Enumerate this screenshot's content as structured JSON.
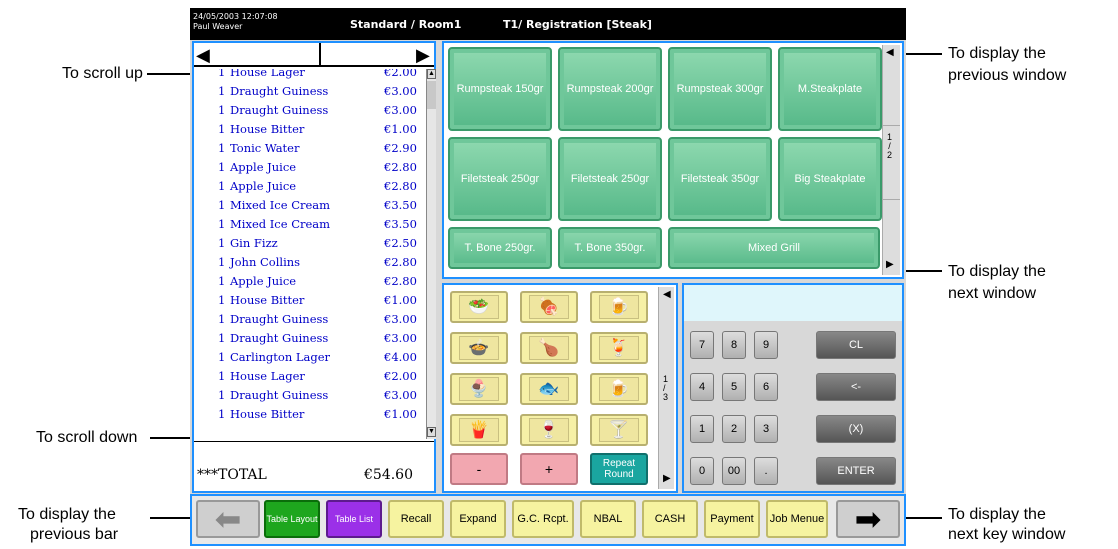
{
  "annotations": {
    "scroll_up": "To scroll up",
    "scroll_down": "To scroll down",
    "prev_bar_1": "To display the",
    "prev_bar_2": "previous bar",
    "prev_window_1": "To display the",
    "prev_window_2": "previous window",
    "next_window_1": "To display the",
    "next_window_2": "next window",
    "next_key_1": "To display the",
    "next_key_2": "next key window"
  },
  "topbar": {
    "date": "24/05/2003 12:07:08",
    "user": "Paul Weaver",
    "mode": "Standard / Room1",
    "table": "T1/ Registration [Steak]"
  },
  "order": {
    "items": [
      {
        "qty": "1",
        "name": "House Lager",
        "price": "€2.00"
      },
      {
        "qty": "1",
        "name": "Draught Guiness",
        "price": "€3.00"
      },
      {
        "qty": "1",
        "name": "Draught Guiness",
        "price": "€3.00"
      },
      {
        "qty": "1",
        "name": "House Bitter",
        "price": "€1.00"
      },
      {
        "qty": "1",
        "name": "Tonic Water",
        "price": "€2.90"
      },
      {
        "qty": "1",
        "name": "Apple Juice",
        "price": "€2.80"
      },
      {
        "qty": "1",
        "name": "Apple Juice",
        "price": "€2.80"
      },
      {
        "qty": "1",
        "name": "Mixed Ice Cream",
        "price": "€3.50"
      },
      {
        "qty": "1",
        "name": "Mixed Ice Cream",
        "price": "€3.50"
      },
      {
        "qty": "1",
        "name": "Gin Fizz",
        "price": "€2.50"
      },
      {
        "qty": "1",
        "name": "John Collins",
        "price": "€2.80"
      },
      {
        "qty": "1",
        "name": "Apple Juice",
        "price": "€2.80"
      },
      {
        "qty": "1",
        "name": "House Bitter",
        "price": "€1.00"
      },
      {
        "qty": "1",
        "name": "Draught Guiness",
        "price": "€3.00"
      },
      {
        "qty": "1",
        "name": "Draught Guiness",
        "price": "€3.00"
      },
      {
        "qty": "1",
        "name": "Carlington Lager",
        "price": "€4.00"
      },
      {
        "qty": "1",
        "name": "House Lager",
        "price": "€2.00"
      },
      {
        "qty": "1",
        "name": "Draught Guiness",
        "price": "€3.00"
      },
      {
        "qty": "1",
        "name": "House Bitter",
        "price": "€1.00"
      }
    ],
    "total_label": "***TOTAL",
    "total_value": "€54.60"
  },
  "menu": {
    "buttons": [
      "Rumpsteak 150gr",
      "Rumpsteak 200gr",
      "Rumpsteak 300gr",
      "M.Steakplate",
      "Filetsteak 250gr",
      "Filetsteak 250gr",
      "Filetsteak 350gr",
      "Big Steakplate",
      "T. Bone 250gr.",
      "T. Bone 350gr.",
      "Mixed Grill"
    ],
    "page_num": "1",
    "page_total": "2"
  },
  "icons": {
    "glyphs": [
      "🥗",
      "🍖",
      "🍺",
      "🍲",
      "🍗",
      "🍹",
      "🍨",
      "🐟",
      "🍺",
      "🍟",
      "🍷",
      "🍸"
    ],
    "minus": "-",
    "plus": "+",
    "repeat": "Repeat Round",
    "page_num": "1",
    "page_total": "3"
  },
  "keypad": {
    "digits": [
      "7",
      "8",
      "9",
      "4",
      "5",
      "6",
      "1",
      "2",
      "3",
      "0",
      "00",
      "."
    ],
    "funcs": [
      "CL",
      "<-",
      "(X)",
      "ENTER"
    ]
  },
  "bottombar": {
    "table_layout": "Table Layout",
    "table_list": "Table List",
    "recall": "Recall",
    "expand": "Expand",
    "gc_rcpt": "G.C. Rcpt.",
    "nbal": "NBAL",
    "cash": "CASH",
    "payment": "Payment",
    "job_menue": "Job Menue"
  },
  "colors": {
    "accent": "#1e90ff",
    "menu_green": "#55b888",
    "item_blue": "#0000c8"
  }
}
